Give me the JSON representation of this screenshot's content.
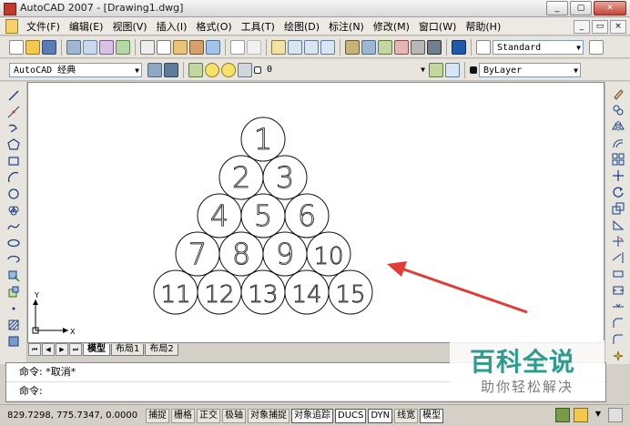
{
  "window": {
    "title": "AutoCAD 2007 - [Drawing1.dwg]",
    "btn_min": "_",
    "btn_max": "▢",
    "btn_close": "✕"
  },
  "menu": [
    "文件(F)",
    "编辑(E)",
    "视图(V)",
    "插入(I)",
    "格式(O)",
    "工具(T)",
    "绘图(D)",
    "标注(N)",
    "修改(M)",
    "窗口(W)",
    "帮助(H)"
  ],
  "mdi": {
    "min": "_",
    "restore": "▭",
    "close": "×"
  },
  "toolbar1": {
    "text_style": "Standard"
  },
  "toolbar2": {
    "workspace": "AutoCAD 经典",
    "layer": "0",
    "color": "ByLayer"
  },
  "drawing": {
    "circles": [
      "1",
      "2",
      "3",
      "4",
      "5",
      "6",
      "7",
      "8",
      "9",
      "10",
      "11",
      "12",
      "13",
      "14",
      "15"
    ],
    "ucs": {
      "x": "X",
      "y": "Y"
    }
  },
  "tabs": {
    "model": "模型",
    "layout1": "布局1",
    "layout2": "布局2"
  },
  "command": {
    "history": "命令: *取消*",
    "prompt": "命令:"
  },
  "status": {
    "coords": "829.7298, 775.7347, 0.0000",
    "toggles": [
      "捕捉",
      "栅格",
      "正交",
      "极轴",
      "对象捕捉",
      "对象追踪",
      "DUCS",
      "DYN",
      "线宽",
      "模型"
    ]
  },
  "watermark": {
    "line1": "百科全说",
    "line2": "助你轻松解决"
  },
  "colors": {
    "accent_arrow": "#e53935",
    "canvas": "#ffffff",
    "chrome": "#d4d0c8"
  }
}
